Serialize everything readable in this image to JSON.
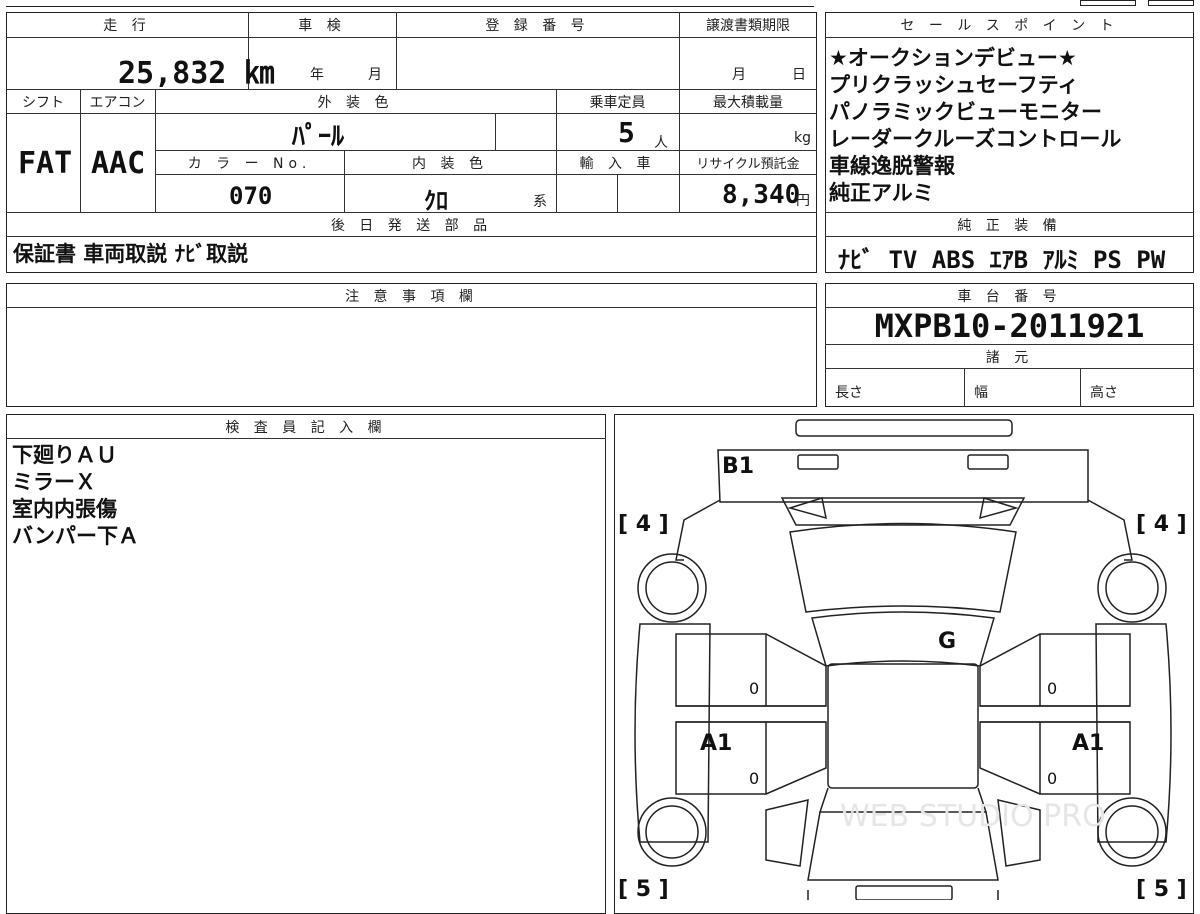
{
  "top_table": {
    "mileage": {
      "label": "走 行",
      "value": "25,832 ㎞"
    },
    "inspection": {
      "label": "車 検",
      "year": "年",
      "month": "月"
    },
    "registration": {
      "label": "登 録 番 号"
    },
    "transfer_deadline": {
      "label": "譲渡書類期限",
      "month": "月",
      "day": "日"
    },
    "shift": {
      "label": "シフト",
      "value": "FAT"
    },
    "aircon": {
      "label": "エアコン",
      "value": "AAC"
    },
    "exterior_color": {
      "label": "外 装 色",
      "value": "ﾊﾟｰﾙ"
    },
    "capacity": {
      "label": "乗車定員",
      "value": "5",
      "unit": "人"
    },
    "max_load": {
      "label": "最大積載量",
      "unit": "kg"
    },
    "color_no": {
      "label": "カ ラ ー No.",
      "value": "070"
    },
    "interior_color": {
      "label": "内 装 色",
      "value": "ｸﾛ",
      "suffix": "系"
    },
    "import": {
      "label": "輸 入 車"
    },
    "recycle": {
      "label": "リサイクル預託金",
      "value": "8,340",
      "unit": "円"
    },
    "later_parts": {
      "label": "後 日 発 送 部 品",
      "value": "保証書 車両取説 ﾅﾋﾞ取説"
    }
  },
  "sales_points": {
    "label": "セ ー ル ス ポ イ ン ト",
    "items": [
      "★オークションデビュー★",
      "プリクラッシュセーフティ",
      "パノラミックビューモニター",
      "レーダークルーズコントロール",
      "車線逸脱警報",
      "純正アルミ"
    ]
  },
  "equipment": {
    "label": "純 正 装 備",
    "value": "ﾅﾋﾞ TV ABS ｴｱB ｱﾙﾐ PS PW"
  },
  "notes": {
    "label": "注 意 事 項 欄"
  },
  "chassis": {
    "label": "車 台 番 号",
    "value": "MXPB10-2011921"
  },
  "specs": {
    "label": "諸 元",
    "length": "長さ",
    "width": "幅",
    "height": "高さ"
  },
  "inspector": {
    "label": "検 査 員 記 入 欄",
    "lines": [
      "下廻りＡＵ",
      "ミラーＸ",
      "室内内張傷",
      "バンパー下Ａ"
    ]
  },
  "diagram": {
    "marks": {
      "b1": "B1",
      "g": "G",
      "a1_left": "A1",
      "a1_right": "A1",
      "zero": "0"
    },
    "tires": {
      "front_left": "[ 4 ]",
      "front_right": "[ 4 ]",
      "rear_left": "[ 5 ]",
      "rear_right": "[ 5 ]"
    },
    "watermark": "WEB STUDIO PRO"
  }
}
